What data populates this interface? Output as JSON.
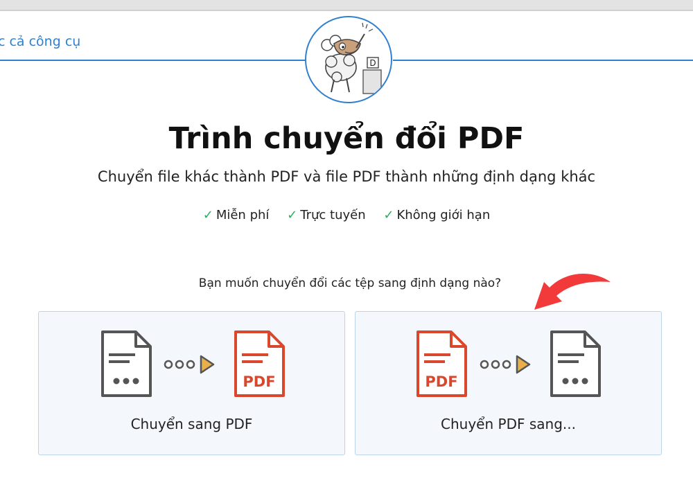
{
  "nav": {
    "all_tools": "c cả công cụ"
  },
  "header": {
    "title": "Trình chuyển đổi PDF",
    "subtitle": "Chuyển file khác thành PDF và file PDF thành những định dạng khác"
  },
  "features": [
    {
      "check": "✓",
      "label": "Miễn phí"
    },
    {
      "check": "✓",
      "label": "Trực tuyến"
    },
    {
      "check": "✓",
      "label": "Không giới hạn"
    }
  ],
  "question": "Bạn muốn chuyển đổi các tệp sang định dạng nào?",
  "cards": [
    {
      "label": "Chuyển sang PDF",
      "badge": "PDF",
      "icons": [
        "document-icon",
        "dots-arrow-icon",
        "pdf-file-icon"
      ]
    },
    {
      "label": "Chuyển PDF sang...",
      "badge": "PDF",
      "icons": [
        "pdf-file-icon",
        "dots-arrow-icon",
        "document-icon"
      ]
    }
  ],
  "colors": {
    "accent": "#2f80d1",
    "pdf_red": "#d9482c",
    "doc_gray": "#555555",
    "arrow_red": "#f23a3a",
    "check_green": "#27ae60",
    "card_bg": "#f4f8fc",
    "card_border": "#bcd3ea"
  },
  "logo": {
    "badge_letter": "D"
  }
}
